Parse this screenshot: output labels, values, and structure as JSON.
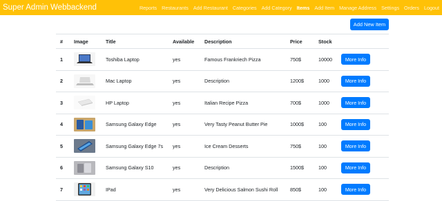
{
  "navbar": {
    "brand": "Super Admin Webbackend",
    "links": [
      {
        "label": "Reports",
        "active": false
      },
      {
        "label": "Restaurants",
        "active": false
      },
      {
        "label": "Add Restaurant",
        "active": false
      },
      {
        "label": "Categories",
        "active": false
      },
      {
        "label": "Add Category",
        "active": false
      },
      {
        "label": "Items",
        "active": true
      },
      {
        "label": "Add Item",
        "active": false
      },
      {
        "label": "Manage Address",
        "active": false
      },
      {
        "label": "Settings",
        "active": false
      },
      {
        "label": "Orders",
        "active": false
      },
      {
        "label": "Logout",
        "active": false
      }
    ],
    "color": "#ffc107"
  },
  "add_button": "Add New Item",
  "table": {
    "headers": [
      "#",
      "Image",
      "Title",
      "Available",
      "Description",
      "Price",
      "Stock",
      ""
    ],
    "rows": [
      {
        "n": "1",
        "image": "laptop-dark",
        "title": "Toshiba Laptop",
        "available": "yes",
        "description": "Famous Frankriech Pizza",
        "price": "750$",
        "stock": "10000",
        "action": "More Info"
      },
      {
        "n": "2",
        "image": "laptop-silver",
        "title": "Mac Laptop",
        "available": "yes",
        "description": "Description",
        "price": "1200$",
        "stock": "1000",
        "action": "More Info"
      },
      {
        "n": "3",
        "image": "laptop-white",
        "title": "HP Laptop",
        "available": "yes",
        "description": "Italian Recipe Pizza",
        "price": "700$",
        "stock": "1000",
        "action": "More Info"
      },
      {
        "n": "4",
        "image": "phones-desk",
        "title": "Samsung Galaxy Edge",
        "available": "yes",
        "description": "Very Tasty Peanut Butter Pie",
        "price": "1000$",
        "stock": "100",
        "action": "More Info"
      },
      {
        "n": "5",
        "image": "phone-blue",
        "title": "Samsung Galaxy Edge 7s",
        "available": "yes",
        "description": "Ice Cream Desserts",
        "price": "750$",
        "stock": "100",
        "action": "More Info"
      },
      {
        "n": "6",
        "image": "phones-gray",
        "title": "Samsung Galaxy S10",
        "available": "yes",
        "description": "Description",
        "price": "1500$",
        "stock": "100",
        "action": "More Info"
      },
      {
        "n": "7",
        "image": "tablet",
        "title": "IPad",
        "available": "yes",
        "description": "Very Delicious Salmon Sushi Roll",
        "price": "850$",
        "stock": "100",
        "action": "More Info"
      }
    ]
  },
  "colors": {
    "primary": "#007bff",
    "border": "#dee2e6"
  }
}
